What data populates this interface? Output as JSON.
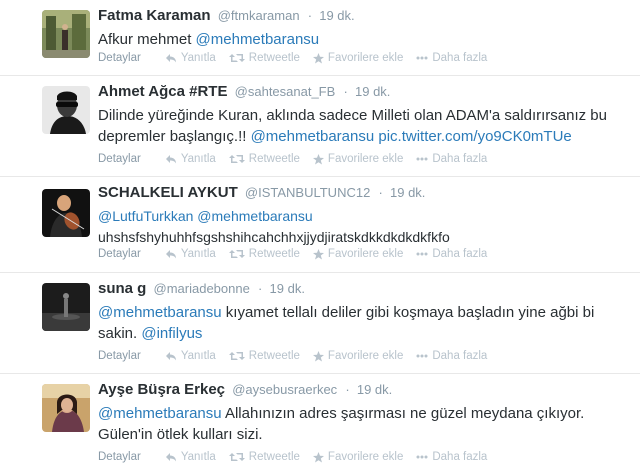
{
  "action_labels": {
    "details": "Detaylar",
    "reply": "Yanıtla",
    "retweet": "Retweetle",
    "favorite": "Favorilere ekle",
    "more": "Daha fazla"
  },
  "tweets": [
    {
      "fullname": "Fatma Karaman",
      "username": "@ftmkaraman",
      "time": "19 dk.",
      "text_parts": [
        {
          "t": "Afkur mehmet ",
          "link": false
        },
        {
          "t": "@mehmetbaransu",
          "link": true
        }
      ]
    },
    {
      "fullname": "Ahmet Ağca #RTE",
      "username": "@sahtesanat_FB",
      "time": "19 dk.",
      "text_parts": [
        {
          "t": "Dilinde yüreğinde Kuran, aklında sadece Milleti ",
          "link": false
        },
        {
          "t": "olan ADAM'a saldırırsanız bu depremler başlangıç.!! ",
          "link": false
        },
        {
          "t": "@mehmetbaransu",
          "link": true
        },
        {
          "t": " ",
          "link": false
        },
        {
          "t": "pic.twitter.com/yo9CK0mTUe",
          "link": true
        }
      ]
    },
    {
      "fullname": "SCHALKELI AYKUT",
      "username": "@ISTANBULTUNC12",
      "time": "19 dk.",
      "text_parts": [
        {
          "t": "@LutfuTurkkan",
          "link": true
        },
        {
          "t": " ",
          "link": false
        },
        {
          "t": "@mehmetbaransu",
          "link": true
        },
        {
          "t": "\nuhshsfshyhuhhfsgshshihcahchhxjjydjiratskdkkdkdkdkfkfo",
          "link": false
        }
      ]
    },
    {
      "fullname": "suna g",
      "username": "@mariadebonne",
      "time": "19 dk.",
      "text_parts": [
        {
          "t": "@mehmetbaransu",
          "link": true
        },
        {
          "t": " kıyamet tellalı deliler gibi koşmaya başladın yine ağbi bi sakin. ",
          "link": false
        },
        {
          "t": "@infilyus",
          "link": true
        }
      ]
    },
    {
      "fullname": "Ayşe Büşra Erkeç",
      "username": "@aysebusraerkec",
      "time": "19 dk.",
      "text_parts": [
        {
          "t": "@mehmetbaransu",
          "link": true
        },
        {
          "t": " Allahınızın adres şaşırması ne güzel meydana çıkıyor. Gülen'in ötlek kulları sizi.",
          "link": false
        }
      ]
    }
  ]
}
